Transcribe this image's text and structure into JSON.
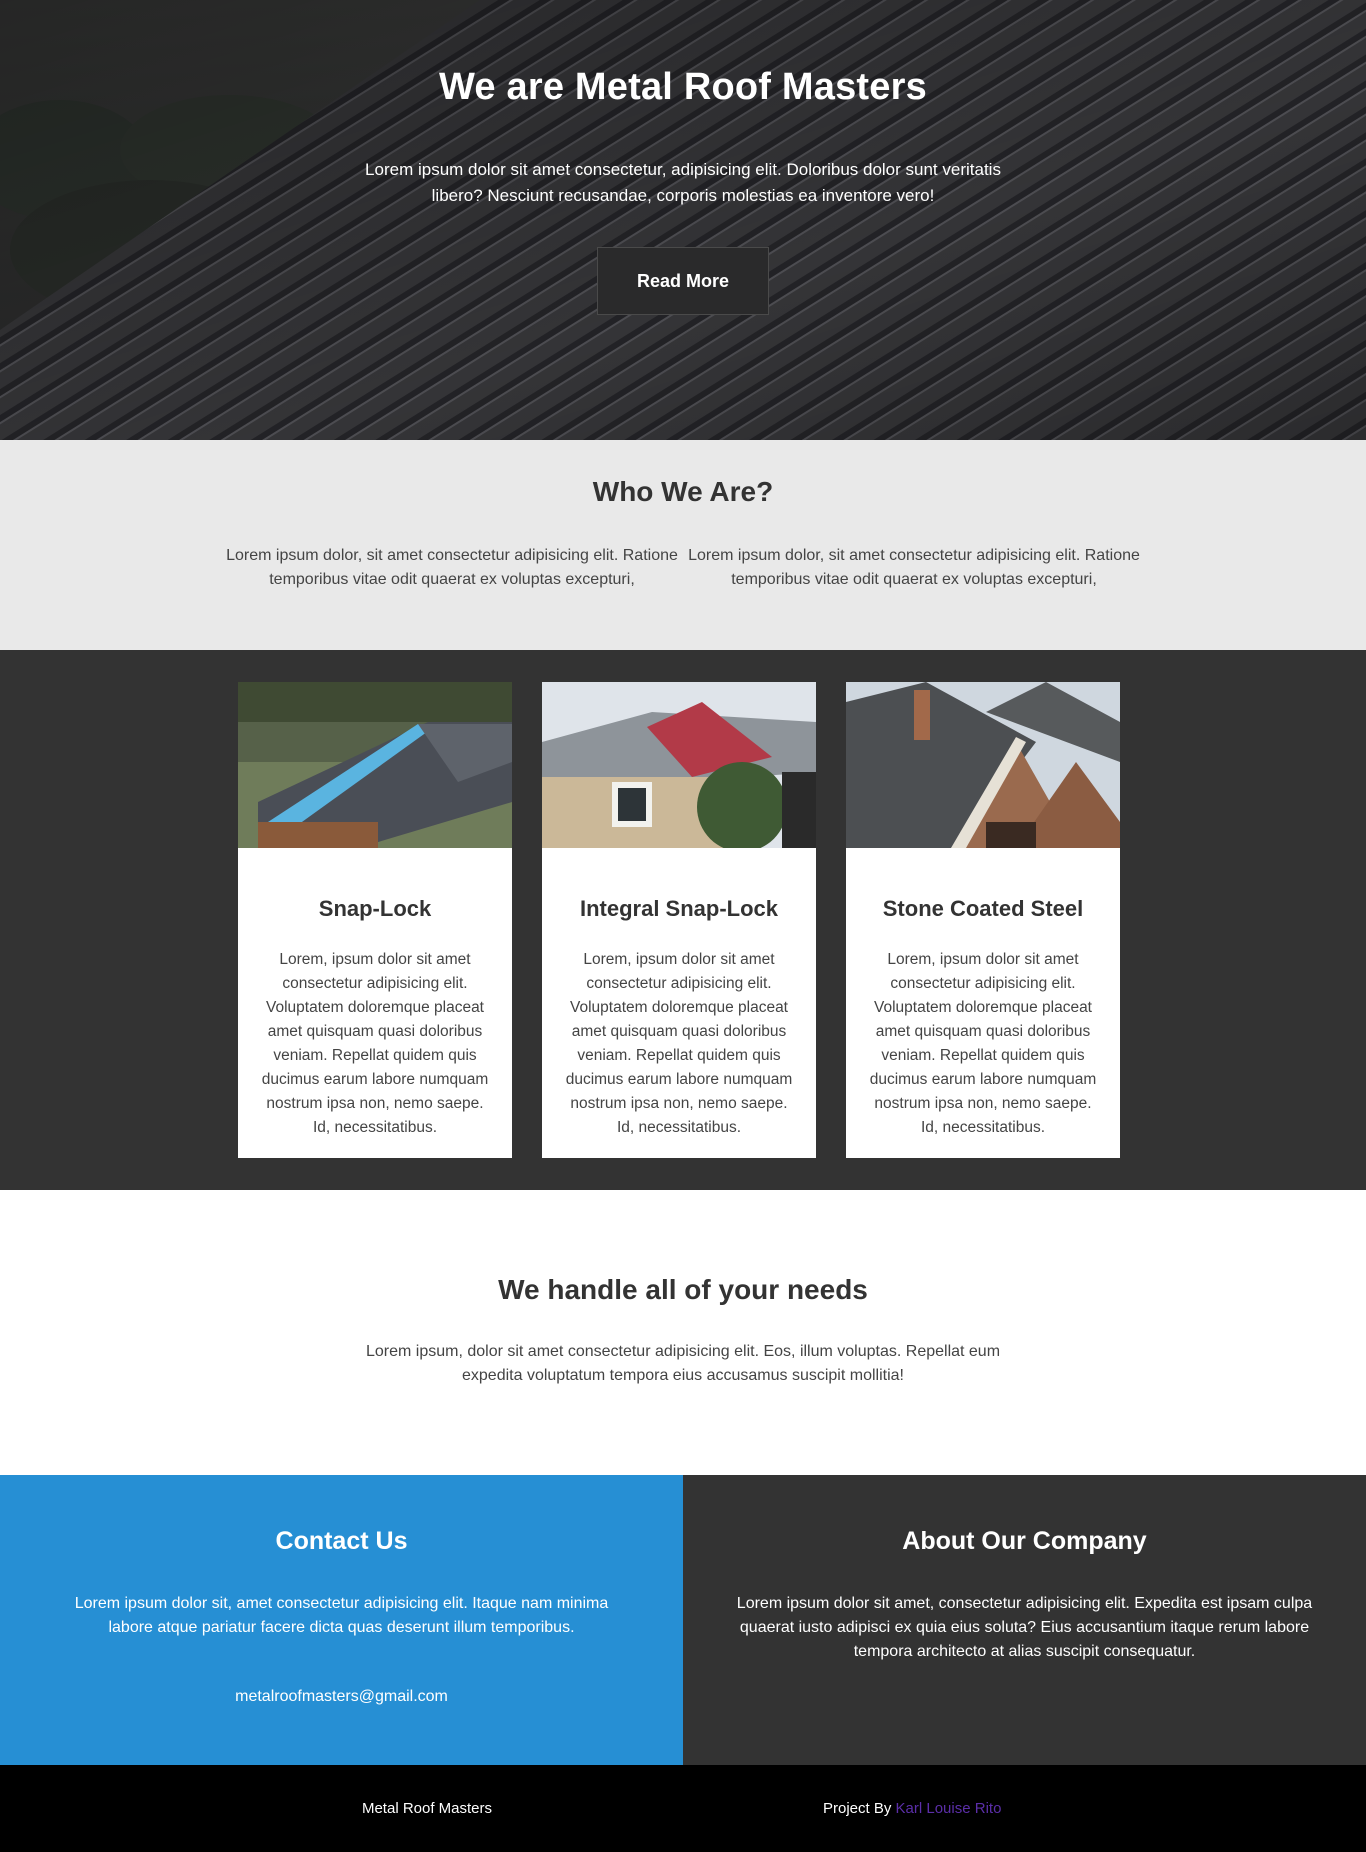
{
  "hero": {
    "title": "We are Metal Roof Masters",
    "text": "Lorem ipsum dolor sit amet consectetur, adipisicing elit. Doloribus dolor sunt veritatis libero? Nesciunt recusandae, corporis molestias ea inventore vero!",
    "button_label": "Read More"
  },
  "who": {
    "title": "Who We Are?",
    "columns": [
      "Lorem ipsum dolor, sit amet consectetur adipisicing elit. Ratione temporibus vitae odit quaerat ex voluptas excepturi,",
      "Lorem ipsum dolor, sit amet consectetur adipisicing elit. Ratione temporibus vitae odit quaerat ex voluptas excepturi,"
    ]
  },
  "cards": [
    {
      "title": "Snap-Lock",
      "text": "Lorem, ipsum dolor sit amet consectetur adipisicing elit. Voluptatem doloremque placeat amet quisquam quasi doloribus veniam. Repellat quidem quis ducimus earum labore numquam nostrum ipsa non, nemo saepe. Id, necessitatibus."
    },
    {
      "title": "Integral Snap-Lock",
      "text": "Lorem, ipsum dolor sit amet consectetur adipisicing elit. Voluptatem doloremque placeat amet quisquam quasi doloribus veniam. Repellat quidem quis ducimus earum labore numquam nostrum ipsa non, nemo saepe. Id, necessitatibus."
    },
    {
      "title": "Stone Coated Steel",
      "text": "Lorem, ipsum dolor sit amet consectetur adipisicing elit. Voluptatem doloremque placeat amet quisquam quasi doloribus veniam. Repellat quidem quis ducimus earum labore numquam nostrum ipsa non, nemo saepe. Id, necessitatibus."
    }
  ],
  "needs": {
    "title": "We handle all of your needs",
    "text": "Lorem ipsum, dolor sit amet consectetur adipisicing elit. Eos, illum voluptas. Repellat eum expedita voluptatum tempora eius accusamus suscipit mollitia!"
  },
  "contact": {
    "title": "Contact Us",
    "text": "Lorem ipsum dolor sit, amet consectetur adipisicing elit. Itaque nam minima labore atque pariatur facere dicta quas deserunt illum temporibus.",
    "email": "metalroofmasters@gmail.com"
  },
  "about": {
    "title": "About Our Company",
    "text": "Lorem ipsum dolor sit amet, consectetur adipisicing elit. Expedita est ipsam culpa quaerat iusto adipisci ex quia eius soluta? Eius accusantium itaque rerum labore tempora architecto at alias suscipit consequatur."
  },
  "footer": {
    "brand": "Metal Roof Masters",
    "credit_prefix": "Project By ",
    "author": "Karl Louise Rito"
  },
  "colors": {
    "contact_bg": "#268fd4",
    "dark_bg": "#333333",
    "author_link": "#5b2ea8"
  }
}
